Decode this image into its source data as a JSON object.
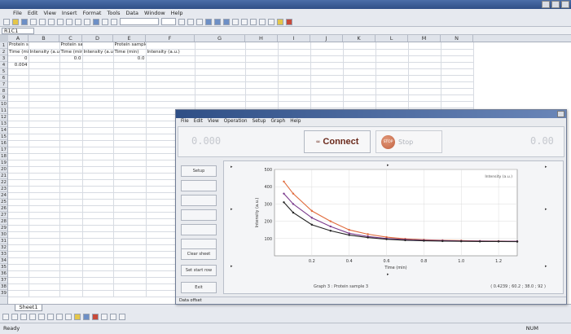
{
  "menubar": {
    "items": [
      "File",
      "Edit",
      "View",
      "Insert",
      "Format",
      "Tools",
      "Data",
      "Window",
      "Help"
    ]
  },
  "formulabar": {
    "namebox": "R1C1"
  },
  "columns": [
    "A",
    "B",
    "C",
    "D",
    "E",
    "F",
    "G",
    "H",
    "I",
    "J",
    "K",
    "L",
    "M",
    "N"
  ],
  "sheet": {
    "header_row": [
      "Protein sample 1",
      "",
      "Protein sample 2",
      "",
      "Protein sample 3",
      ""
    ],
    "sub_row": [
      "Time (min)",
      "Intensity (a.u.)",
      "Time (min)",
      "Intensity (a.u.)",
      "Time (min)",
      "Intensity (a.u.)"
    ],
    "rows": [
      [
        "0",
        "",
        "0.0",
        "",
        "0.0",
        ""
      ],
      [
        "0.004",
        "",
        "",
        "",
        "",
        ""
      ],
      [
        "",
        "",
        "",
        "",
        "",
        ""
      ],
      [
        "",
        "",
        "",
        "",
        "",
        ""
      ],
      [
        "",
        "",
        "",
        "",
        "",
        ""
      ],
      [
        "",
        "",
        "",
        "",
        "",
        ""
      ],
      [
        "",
        "",
        "",
        "",
        "",
        ""
      ],
      [
        "",
        "",
        "",
        "",
        "",
        ""
      ],
      [
        "",
        "",
        "",
        "",
        "",
        ""
      ],
      [
        "",
        "",
        "",
        "",
        "",
        ""
      ],
      [
        "",
        "",
        "",
        "",
        "",
        ""
      ],
      [
        "",
        "",
        "",
        "",
        "",
        ""
      ],
      [
        "",
        "",
        "",
        "",
        "",
        ""
      ],
      [
        "",
        "",
        "",
        "",
        "",
        ""
      ],
      [
        "",
        "",
        "",
        "",
        "",
        ""
      ],
      [
        "",
        "",
        "",
        "",
        "",
        ""
      ],
      [
        "",
        "",
        "",
        "",
        "",
        ""
      ],
      [
        "",
        "",
        "",
        "",
        "",
        ""
      ],
      [
        "",
        "",
        "",
        "",
        "",
        ""
      ],
      [
        "",
        "",
        "",
        "",
        "",
        ""
      ],
      [
        "",
        "",
        "",
        "",
        "",
        ""
      ],
      [
        "",
        "",
        "",
        "",
        "",
        ""
      ],
      [
        "",
        "",
        "",
        "",
        "",
        ""
      ],
      [
        "",
        "",
        "",
        "",
        "",
        ""
      ],
      [
        "",
        "",
        "",
        "",
        "",
        ""
      ],
      [
        "",
        "",
        "",
        "",
        "",
        ""
      ],
      [
        "",
        "",
        "",
        "",
        "",
        ""
      ],
      [
        "",
        "",
        "",
        "",
        "",
        ""
      ],
      [
        "",
        "",
        "",
        "",
        "",
        ""
      ],
      [
        "",
        "",
        "",
        "",
        "",
        ""
      ],
      [
        "",
        "",
        "",
        "",
        "",
        ""
      ],
      [
        "",
        "",
        "",
        "",
        "",
        ""
      ],
      [
        "",
        "",
        "",
        "",
        "",
        ""
      ],
      [
        "",
        "",
        "",
        "",
        "",
        ""
      ],
      [
        "",
        "",
        "",
        "",
        "",
        ""
      ],
      [
        "",
        "",
        "",
        "",
        "",
        ""
      ],
      [
        "",
        "",
        "",
        "",
        "",
        ""
      ]
    ]
  },
  "sheettabs": {
    "active": "Sheet1"
  },
  "statusbar": {
    "left": "Ready",
    "right": "NUM"
  },
  "dialog": {
    "menu": [
      "File",
      "Edit",
      "View",
      "Operation",
      "Setup",
      "Graph",
      "Help"
    ],
    "left_readout": "0.000",
    "connect_label": "Connect",
    "stop_label": "Stop",
    "stop_dot_text": "STOP",
    "right_readout": "0.00",
    "side_buttons": [
      "Setup",
      "",
      "",
      "",
      "",
      "",
      "Clear sheet",
      "Set start row",
      "Exit"
    ],
    "status": "Data offset"
  },
  "chart_data": {
    "type": "line",
    "xlabel": "Time (min)",
    "ylabel": "Intensity (a.u.)",
    "xlim": [
      0,
      1.3
    ],
    "ylim": [
      0,
      500
    ],
    "xticks": [
      "0.2",
      "0.4",
      "0.6",
      "0.8",
      "1.0",
      "1.2"
    ],
    "yticks": [
      "100",
      "200",
      "300",
      "400",
      "500"
    ],
    "legend": "Intensity (a.u.)",
    "caption_left": "Graph 3 : Protein sample 3",
    "caption_right": "( 0.4239 ; 60.2 ; 38.0 ; 92 )",
    "series": [
      {
        "color": "#e06a3b",
        "x": [
          0.05,
          0.1,
          0.2,
          0.3,
          0.4,
          0.5,
          0.6,
          0.7,
          0.8,
          0.9,
          1.0,
          1.1,
          1.2,
          1.3
        ],
        "y": [
          430,
          360,
          260,
          200,
          150,
          125,
          108,
          98,
          93,
          90,
          88,
          86,
          85,
          84
        ]
      },
      {
        "color": "#7a3a8c",
        "x": [
          0.05,
          0.1,
          0.2,
          0.3,
          0.4,
          0.5,
          0.6,
          0.7,
          0.8,
          0.9,
          1.0,
          1.1,
          1.2,
          1.3
        ],
        "y": [
          360,
          300,
          220,
          170,
          130,
          112,
          100,
          94,
          90,
          88,
          86,
          85,
          84,
          84
        ]
      },
      {
        "color": "#222222",
        "x": [
          0.05,
          0.1,
          0.2,
          0.3,
          0.4,
          0.5,
          0.6,
          0.7,
          0.8,
          0.9,
          1.0,
          1.1,
          1.2,
          1.3
        ],
        "y": [
          310,
          250,
          180,
          145,
          120,
          106,
          96,
          90,
          87,
          85,
          84,
          83,
          83,
          82
        ]
      }
    ]
  }
}
